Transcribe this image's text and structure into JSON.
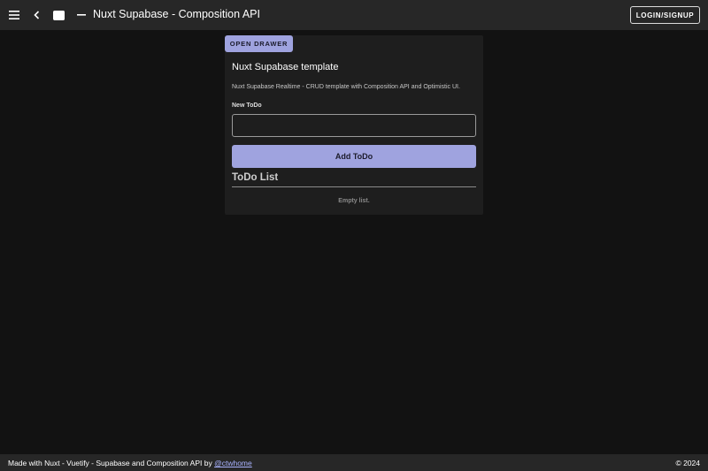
{
  "appbar": {
    "title": "Nuxt Supabase - Composition API",
    "login_label": "LOGIN/SIGNUP",
    "icons": [
      "menu-icon",
      "chevron-left-icon",
      "window-icon",
      "minus-icon"
    ]
  },
  "card": {
    "drawer_label": "OPEN DRAWER",
    "title": "Nuxt Supabase template",
    "subtitle": "Nuxt Supabase Realtime - CRUD template with Composition API and Optimistic UI.",
    "new_todo_label": "New ToDo",
    "new_todo_value": "",
    "add_label": "Add ToDo",
    "list_title": "ToDo List",
    "empty_text": "Empty list."
  },
  "footer": {
    "text": "Made with Nuxt - Vuetify - Supabase and Composition API by ",
    "link": "@ctwhome",
    "copyright": "© 2024"
  },
  "colors": {
    "background": "#121212",
    "appbar": "#272727",
    "card": "#1e1e1e",
    "primary": "#9fa3df",
    "link": "#a9b3ff"
  }
}
